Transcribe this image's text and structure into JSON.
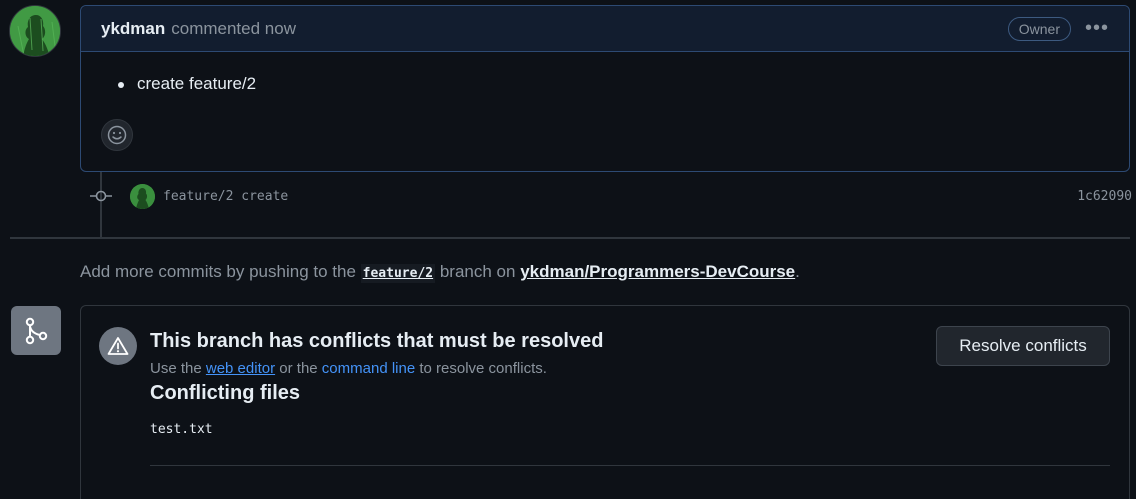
{
  "comment": {
    "author": "ykdman",
    "meta": "commented now",
    "badge": "Owner",
    "menu_icon": "kebab-horizontal-icon",
    "body_items": [
      "create feature/2"
    ],
    "reaction_icon": "smiley-icon"
  },
  "commit": {
    "message": "feature/2 create",
    "sha": "1c62090",
    "node_icon": "git-commit-icon"
  },
  "push_hint": {
    "prefix": "Add more commits by pushing to the",
    "branch": "feature/2",
    "middle": "branch on",
    "repo": "ykdman/Programmers-DevCourse",
    "suffix": "."
  },
  "merge_box": {
    "icon": "git-merge-icon",
    "warning_icon": "alert-icon",
    "title": "This branch has conflicts that must be resolved",
    "sub_prefix": "Use the",
    "web_editor_link": "web editor",
    "sub_or": "or the",
    "command_line_link": "command line",
    "sub_suffix": "to resolve conflicts.",
    "files_heading": "Conflicting files",
    "files": [
      "test.txt"
    ],
    "resolve_button": "Resolve conflicts"
  },
  "colors": {
    "background": "#0d1117",
    "header_bg": "#121d2f",
    "link": "#4493f8",
    "muted": "#8b949e",
    "avatar_green": "#2f7d32"
  }
}
